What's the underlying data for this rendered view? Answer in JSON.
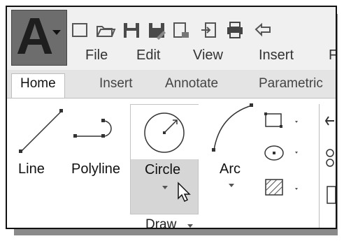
{
  "menu": [
    "File",
    "Edit",
    "View",
    "Insert",
    "F"
  ],
  "tabs": [
    "Home",
    "Insert",
    "Annotate",
    "Parametric"
  ],
  "tools": {
    "line": "Line",
    "polyline": "Polyline",
    "circle": "Circle",
    "arc": "Arc"
  },
  "panel_title": "Draw"
}
